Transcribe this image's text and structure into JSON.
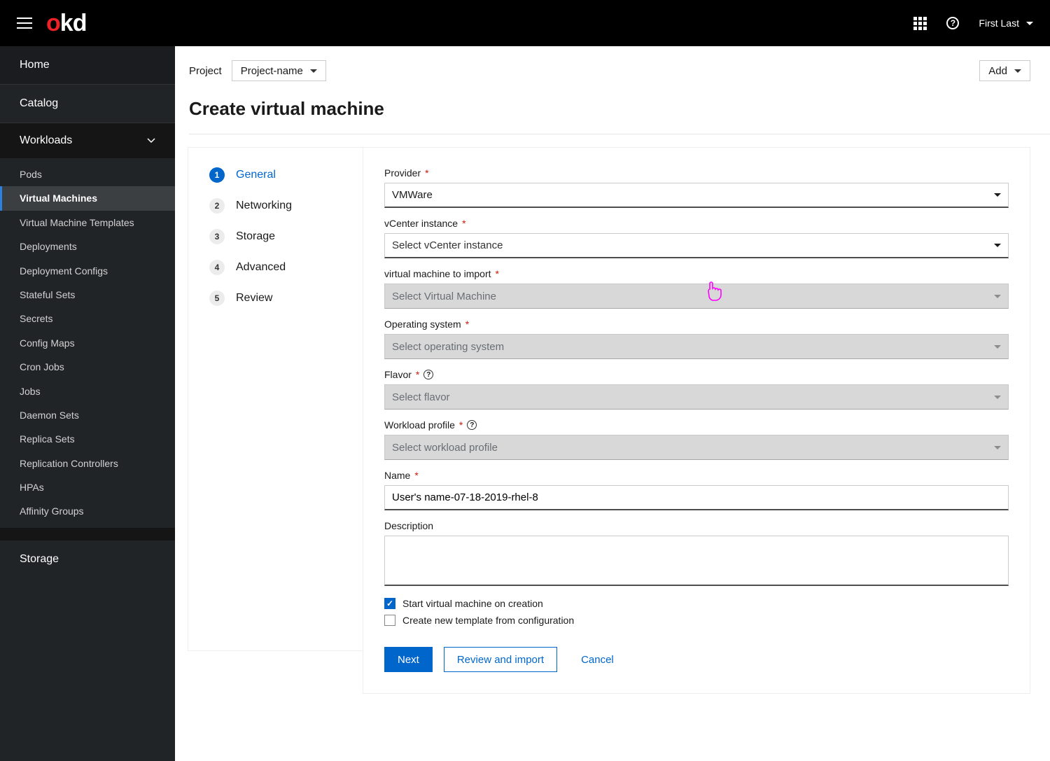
{
  "masthead": {
    "logo_o": "o",
    "logo_kd": "kd",
    "user": "First Last"
  },
  "add_button": "Add",
  "project": {
    "label": "Project",
    "selected": "Project-name"
  },
  "page_title": "Create virtual machine",
  "sidebar": {
    "home": "Home",
    "catalog": "Catalog",
    "section": "Workloads",
    "items": [
      "Pods",
      "Virtual Machines",
      "Virtual Machine Templates",
      "Deployments",
      "Deployment Configs",
      "Stateful Sets",
      "Secrets",
      "Config Maps",
      "Cron Jobs",
      "Jobs",
      "Daemon Sets",
      "Replica Sets",
      "Replication Controllers",
      "HPAs",
      "Affinity Groups"
    ],
    "active_index": 1,
    "bottom_section": "Storage"
  },
  "wizard": {
    "steps": [
      {
        "num": "1",
        "label": "General"
      },
      {
        "num": "2",
        "label": "Networking"
      },
      {
        "num": "3",
        "label": "Storage"
      },
      {
        "num": "4",
        "label": "Advanced"
      },
      {
        "num": "5",
        "label": "Review"
      }
    ],
    "active_index": 0
  },
  "form": {
    "provider": {
      "label": "Provider",
      "value": "VMWare",
      "required": true
    },
    "vcenter": {
      "label": "vCenter instance",
      "placeholder": "Select vCenter instance",
      "required": true
    },
    "vm_import": {
      "label": "virtual machine to import",
      "placeholder": "Select Virtual Machine",
      "required": true,
      "disabled": true
    },
    "os": {
      "label": "Operating system",
      "placeholder": "Select operating system",
      "required": true,
      "disabled": true
    },
    "flavor": {
      "label": "Flavor",
      "placeholder": "Select flavor",
      "required": true,
      "disabled": true,
      "help": true
    },
    "workload": {
      "label": "Workload profile",
      "placeholder": "Select workload profile",
      "required": true,
      "disabled": true,
      "help": true
    },
    "name": {
      "label": "Name",
      "value": "User's name-07-18-2019-rhel-8",
      "required": true
    },
    "description": {
      "label": "Description",
      "value": ""
    },
    "cb_start": {
      "label": "Start virtual machine on creation",
      "checked": true
    },
    "cb_template": {
      "label": "Create new template from configuration",
      "checked": false
    }
  },
  "actions": {
    "next": "Next",
    "review": "Review and import",
    "cancel": "Cancel"
  }
}
